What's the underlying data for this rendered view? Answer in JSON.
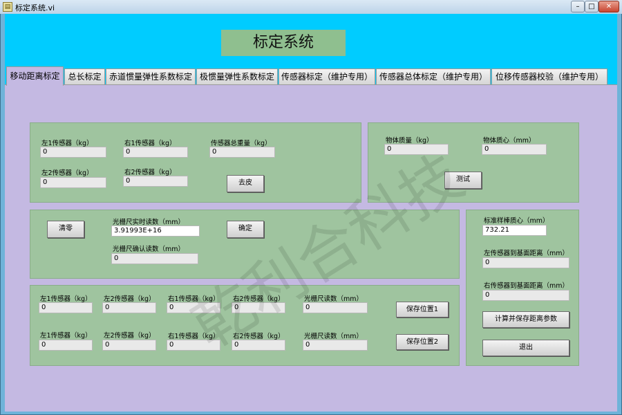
{
  "window": {
    "title": "标定系统.vi",
    "min": "–",
    "max": "□",
    "close": "✕",
    "icon": "labview-vi-icon"
  },
  "banner": "标定系统",
  "tabs": [
    "移动距离标定",
    "总长标定",
    "赤道惯量弹性系数标定",
    "极惯量弹性系数标定",
    "传感器标定（维护专用）",
    "传感器总体标定（维护专用）",
    "位移传感器校验（维护专用）"
  ],
  "active_tab": "移动距离标定",
  "sensors": {
    "left1_label": "左1传感器（kg）",
    "left1_value": "0",
    "right1_label": "右1传感器（kg）",
    "right1_value": "0",
    "total_label": "传感器总重量（kg）",
    "total_value": "0",
    "left2_label": "左2传感器（kg）",
    "left2_value": "0",
    "right2_label": "右2传感器（kg）",
    "right2_value": "0",
    "tare_button": "去皮"
  },
  "object": {
    "mass_label": "物体质量（kg）",
    "mass_value": "0",
    "centroid_label": "物体质心（mm）",
    "centroid_value": "0",
    "test_button": "测试"
  },
  "grating": {
    "zero_button": "清零",
    "realtime_label": "光栅尺实时读数（mm）",
    "realtime_value": "3.91993E+16",
    "confirm_button": "确定",
    "confirm_label": "光栅尺确认读数（mm）",
    "confirm_value": "0"
  },
  "positions": [
    {
      "left1_label": "左1传感器（kg）",
      "left1": "0",
      "left2_label": "左2传感器（kg）",
      "left2": "0",
      "right1_label": "右1传感器（kg）",
      "right1": "0",
      "right2_label": "右2传感器（kg）",
      "right2": "0",
      "grating_label": "光栅尺读数（mm）",
      "grating": "0",
      "save_button": "保存位置1"
    },
    {
      "left1_label": "左1传感器（kg）",
      "left1": "0",
      "left2_label": "左2传感器（kg）",
      "left2": "0",
      "right1_label": "右1传感器（kg）",
      "right1": "0",
      "right2_label": "右2传感器（kg）",
      "right2": "0",
      "grating_label": "光栅尺读数（mm）",
      "grating": "0",
      "save_button": "保存位置2"
    }
  ],
  "standard": {
    "centroid_label": "标准样棒质心（mm）",
    "centroid_value": "732.21",
    "left_dist_label": "左传感器到基面距离（mm）",
    "left_dist_value": "0",
    "right_dist_label": "右传感器到基面距离（mm）",
    "right_dist_value": "0",
    "calc_button": "计算并保存距离参数",
    "exit_button": "退出"
  },
  "watermark": "乾利合科技",
  "colors": {
    "client_bg": "#00ccff",
    "tab_panel": "#c4b9e2",
    "group_panel": "#9fc49f",
    "banner": "#8fbf8f"
  }
}
